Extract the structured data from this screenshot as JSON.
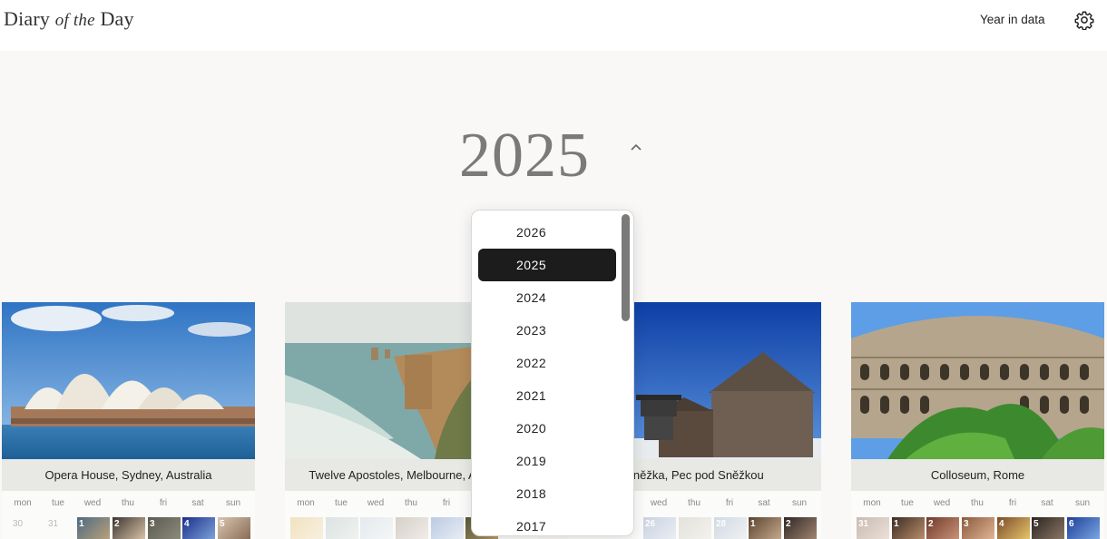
{
  "header": {
    "logo_part1": "Diary",
    "logo_italic": "of the",
    "logo_part2": "Day",
    "year_in_data_label": "Year in data",
    "settings_icon": "gear-icon"
  },
  "selected_year": "2025",
  "year_dropdown": {
    "options": [
      "2026",
      "2025",
      "2024",
      "2023",
      "2022",
      "2021",
      "2020",
      "2019",
      "2018",
      "2017"
    ],
    "selected": "2025"
  },
  "weekday_labels": [
    "mon",
    "tue",
    "wed",
    "thu",
    "fri",
    "sat",
    "sun"
  ],
  "cards": [
    {
      "caption": "Opera House, Sydney, Australia",
      "day_numbers": [
        "30",
        "31",
        "1",
        "2",
        "3",
        "4",
        "5"
      ]
    },
    {
      "caption": "Twelve Apostoles, Melbourne, Australia",
      "day_numbers": [
        "",
        "",
        "",
        "",
        "",
        "",
        ""
      ]
    },
    {
      "caption": "Sněžka, Pec pod Sněžkou",
      "day_numbers": [
        "",
        "",
        "26",
        "",
        "28",
        "1",
        "2"
      ]
    },
    {
      "caption": "Colloseum, Rome",
      "day_numbers": [
        "31",
        "1",
        "2",
        "3",
        "4",
        "5",
        "6"
      ]
    }
  ],
  "colors": {
    "background": "#f9f8f6",
    "selected_option": "#1c1c1c",
    "caption_bg": "#e8e9e4"
  }
}
